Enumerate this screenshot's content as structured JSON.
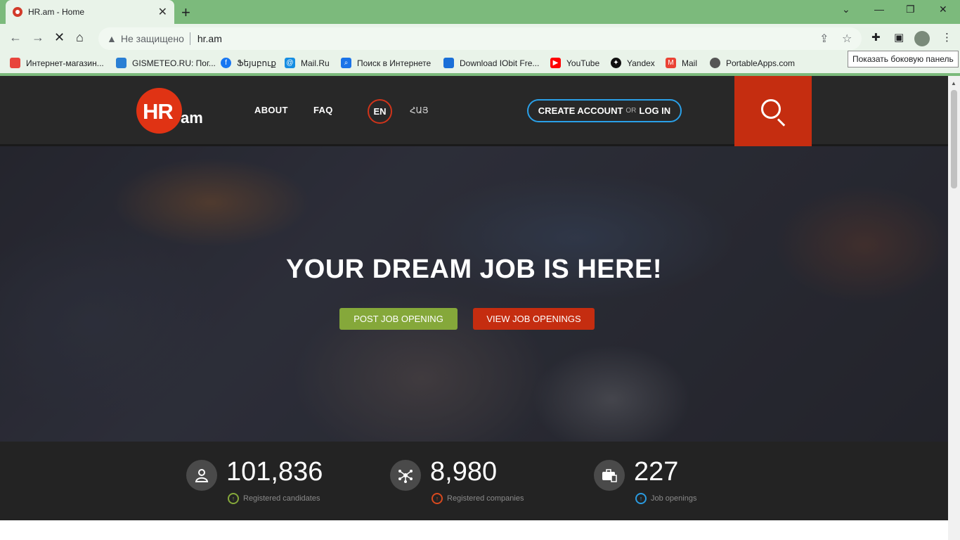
{
  "browser": {
    "tab_title": "HR.am - Home",
    "tab_close": "✕",
    "new_tab": "+",
    "window_controls": {
      "minimize": "—",
      "maximize": "❐",
      "close": "✕",
      "tabsearch": "⌄"
    },
    "security_label": "Не защищено",
    "url": "hr.am",
    "tooltip": "Показать боковую панель",
    "bookmarks": [
      {
        "label": "Интернет-магазин...",
        "color": "#e8453c"
      },
      {
        "label": "GISMETEO.RU: Пог...",
        "color": "#2a7fd4"
      },
      {
        "label": "Ֆեյսբուք",
        "color": "#1877f2"
      },
      {
        "label": "Mail.Ru",
        "color": "#168de2"
      },
      {
        "label": "Поиск в Интернете",
        "color": "#1a73e8"
      },
      {
        "label": "Download IObit Fre...",
        "color": "#1a6fd8"
      },
      {
        "label": "YouTube",
        "color": "#ff0000"
      },
      {
        "label": "Yandex",
        "color": "#111111"
      },
      {
        "label": "Mail",
        "color": "#ea4335"
      },
      {
        "label": "PortableApps.com",
        "color": "#555555"
      }
    ]
  },
  "site": {
    "logo_hr": "HR",
    "logo_am": "am",
    "nav": {
      "about": "ABOUT",
      "faq": "FAQ"
    },
    "lang": {
      "en": "EN",
      "hy": "ՀԱՅ"
    },
    "account": {
      "create": "CREATE ACCOUNT",
      "or": "OR",
      "login": "LOG IN"
    },
    "hero": {
      "headline": "YOUR DREAM JOB IS HERE!",
      "post_button": "POST JOB OPENING",
      "view_button": "VIEW JOB OPENINGS"
    },
    "stats": [
      {
        "value": "101,836",
        "label": "Registered candidates",
        "color": "#85a83a",
        "icon": "candidate-icon"
      },
      {
        "value": "8,980",
        "label": "Registered companies",
        "color": "#d8491e",
        "icon": "network-icon"
      },
      {
        "value": "227",
        "label": "Job openings",
        "color": "#2a9be0",
        "icon": "briefcase-icon"
      }
    ]
  },
  "colors": {
    "brand_red": "#e03314",
    "green": "#85a83a",
    "blue": "#2aa0e8",
    "chrome_green": "#7cba7c"
  }
}
